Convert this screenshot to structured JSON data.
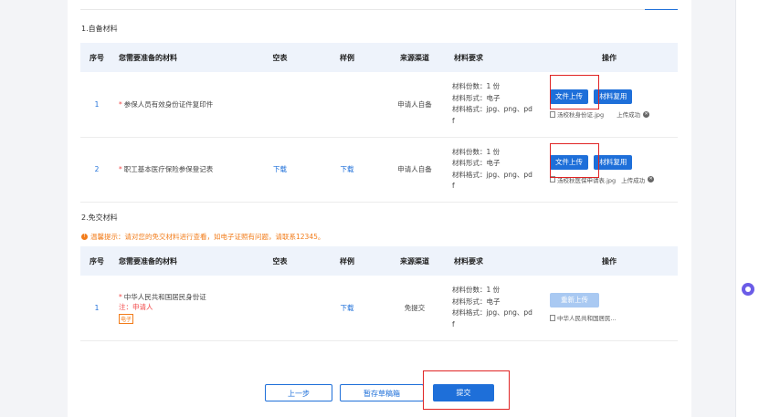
{
  "section1": {
    "title": "1.自备材料",
    "headers": [
      "序号",
      "您需要准备的材料",
      "空表",
      "样例",
      "来源渠道",
      "材料要求",
      "操作"
    ],
    "rows": [
      {
        "index": "1",
        "name": "参保人员有效身份证件复印件",
        "blank": "",
        "sample": "",
        "source": "申请人自备",
        "req": [
          "材料份数：1 份",
          "材料形式：电子",
          "材料格式：jpg、png、pd",
          "f"
        ],
        "upload": "文件上传",
        "reuse": "材料复用",
        "file": "汤校秋身份证.jpg",
        "status": "上传成功"
      },
      {
        "index": "2",
        "name": "职工基本医疗保险参保登记表",
        "blank": "下载",
        "sample": "下载",
        "source": "申请人自备",
        "req": [
          "材料份数：1 份",
          "材料形式：电子",
          "材料格式：jpg、png、pd",
          "f"
        ],
        "upload": "文件上传",
        "reuse": "材料复用",
        "file": "汤校秋医保申请表.jpg",
        "status": "上传成功"
      }
    ]
  },
  "section2": {
    "title": "2.免交材料",
    "tip": "温馨提示：请对您的免交材料进行查看，如电子证照有问题，请联系12345。",
    "headers": [
      "序号",
      "您需要准备的材料",
      "空表",
      "样例",
      "来源渠道",
      "材料要求",
      "操作"
    ],
    "rows": [
      {
        "index": "1",
        "name": "中华人民共和国居民身份证",
        "note": "注：申请人",
        "stamp": "电子",
        "blank": "",
        "sample": "下载",
        "source": "免提交",
        "req": [
          "材料份数：1 份",
          "材料形式：电子",
          "材料格式：jpg、png、pd",
          "f"
        ],
        "reupload": "重新上传",
        "file": "中华人民共和国居民..."
      }
    ]
  },
  "footer": {
    "prev": "上一步",
    "draft": "暂存草稿箱",
    "submit": "提交"
  },
  "colors": {
    "primary": "#1e6fd9",
    "highlight": "#e02424",
    "warning": "#f27c1a",
    "header_bg": "#eef3fb"
  }
}
